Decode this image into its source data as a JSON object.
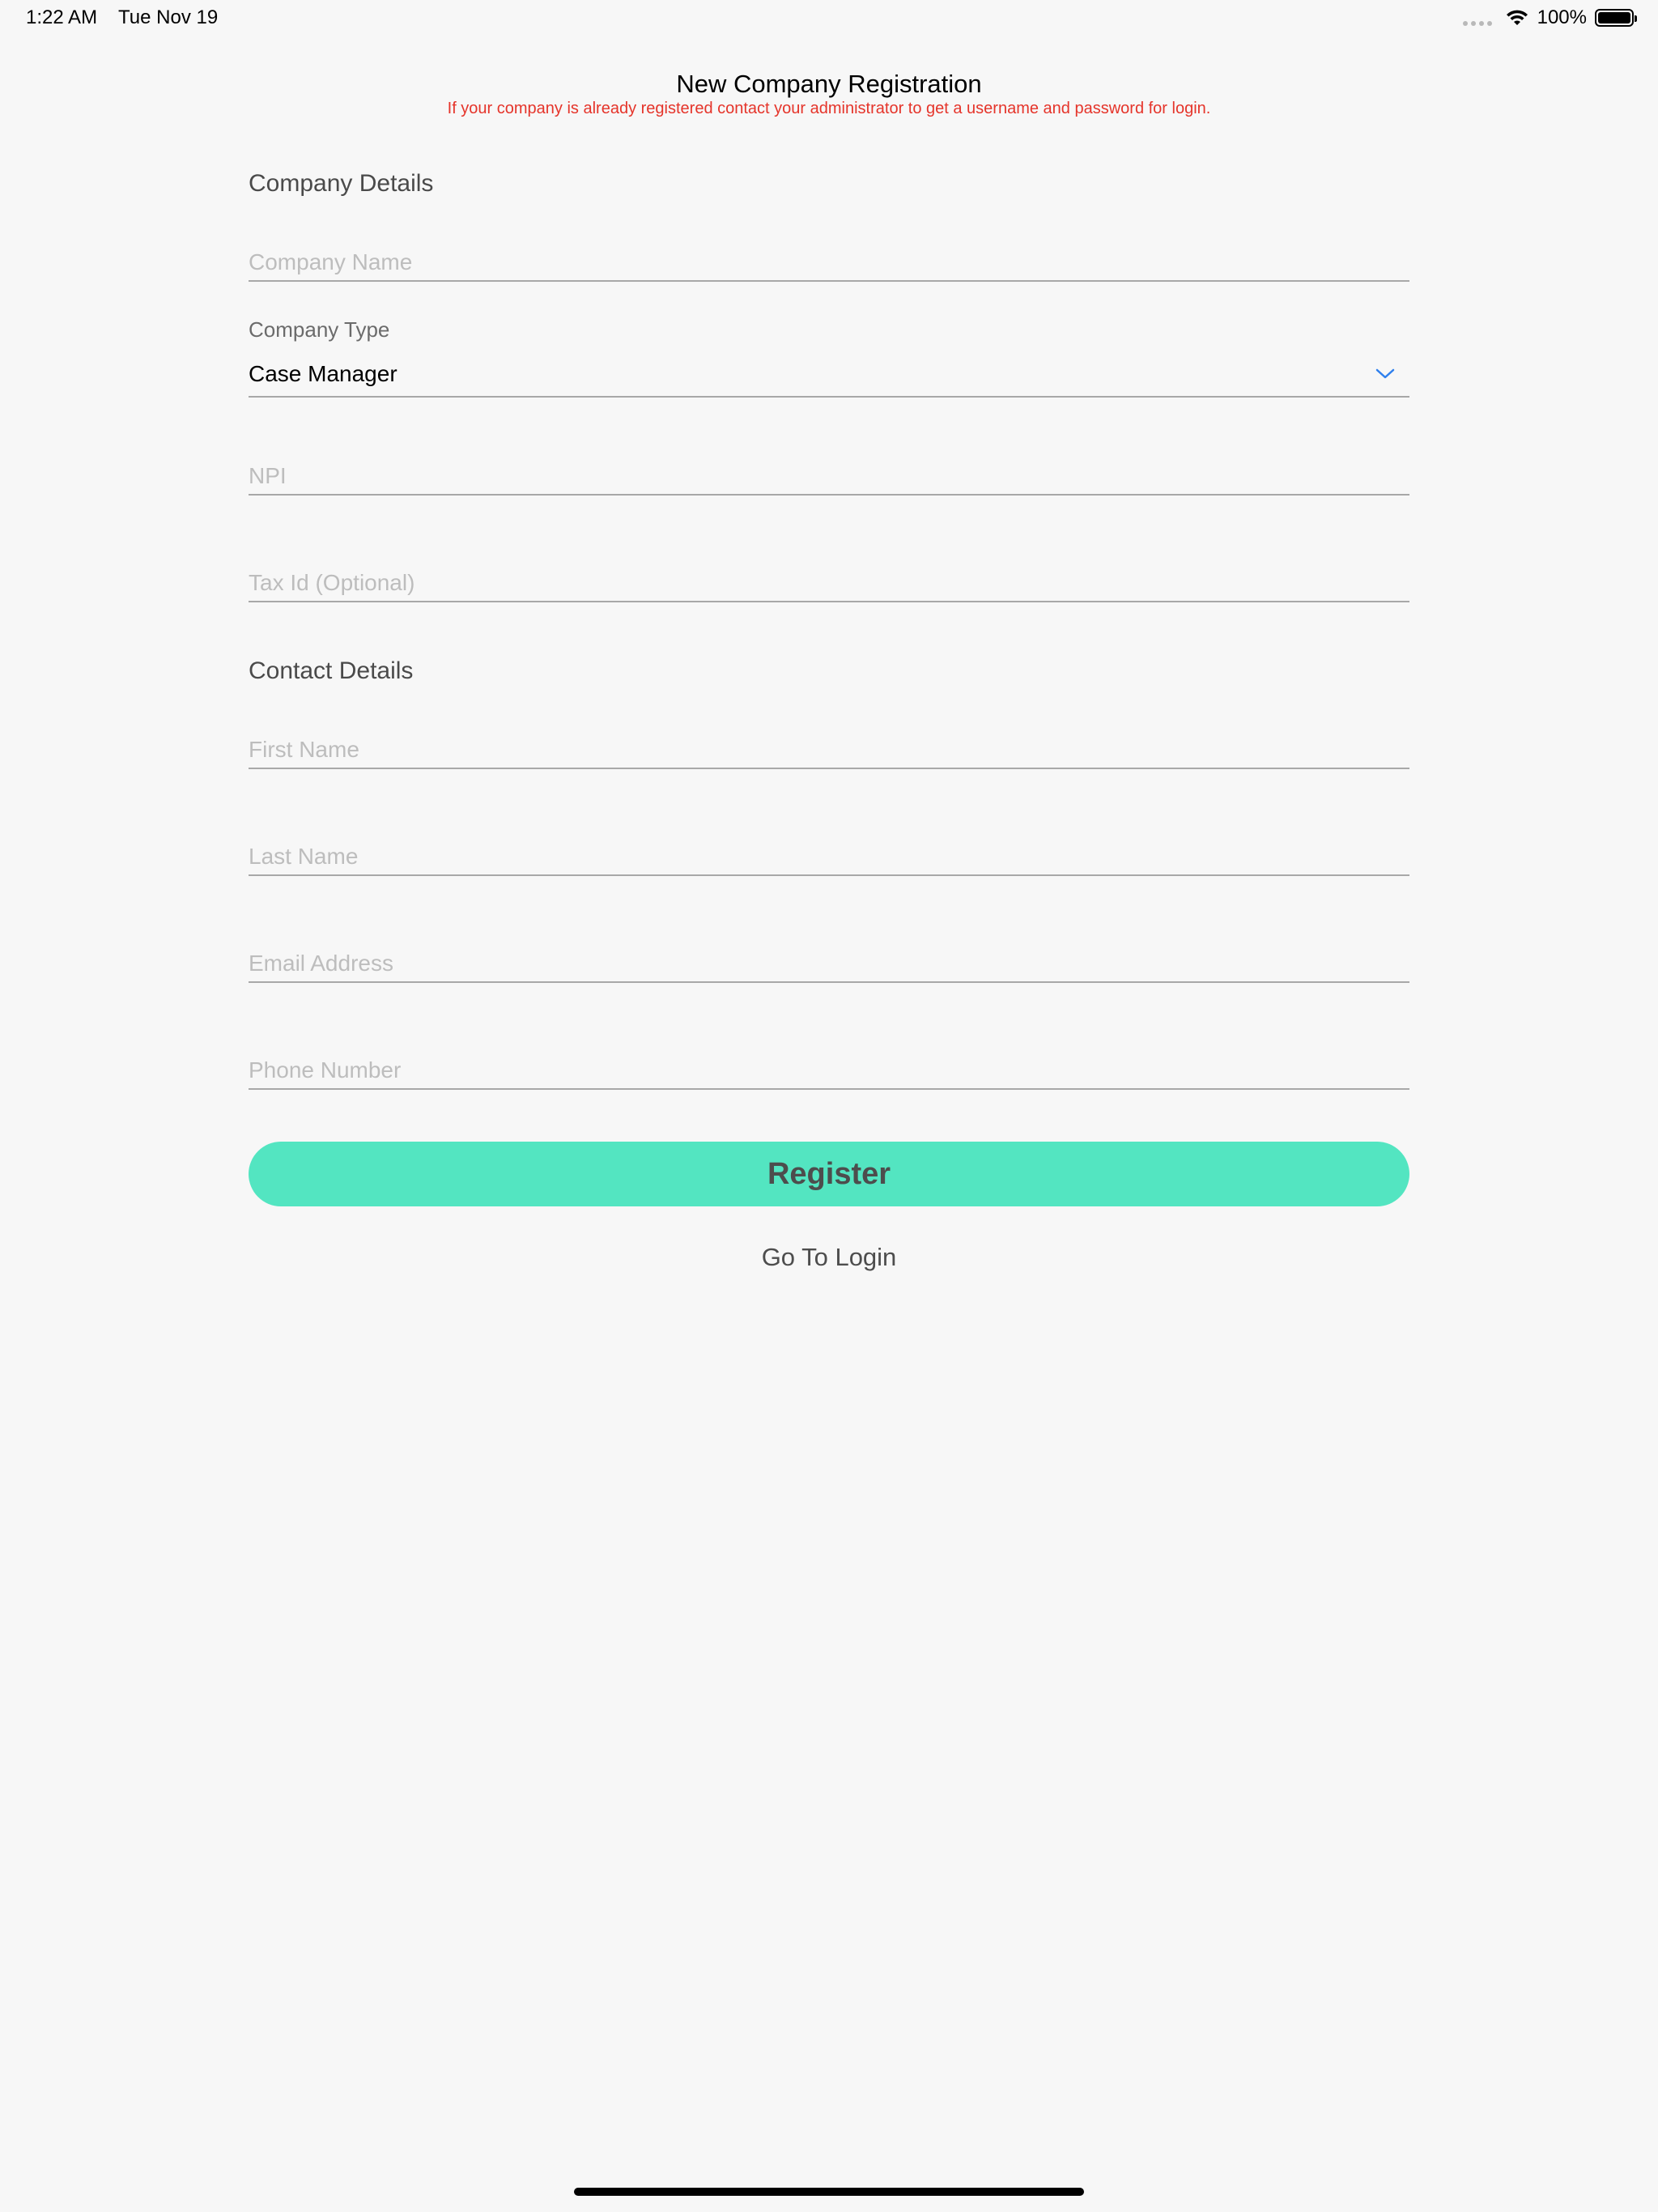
{
  "status_bar": {
    "time": "1:22 AM",
    "date": "Tue Nov 19",
    "battery": "100%"
  },
  "header": {
    "title": "New Company Registration",
    "notice": "If your company is already registered contact your administrator to get a username and password for login."
  },
  "company_details": {
    "heading": "Company Details",
    "company_name_placeholder": "Company Name",
    "company_type_label": "Company Type",
    "company_type_value": "Case Manager",
    "npi_placeholder": "NPI",
    "tax_id_placeholder": "Tax Id (Optional)"
  },
  "contact_details": {
    "heading": "Contact Details",
    "first_name_placeholder": "First Name",
    "last_name_placeholder": "Last Name",
    "email_placeholder": "Email Address",
    "phone_placeholder": "Phone Number"
  },
  "actions": {
    "register_label": "Register",
    "login_label": "Go To Login"
  },
  "colors": {
    "accent": "#53e5c1",
    "notice": "#e5342a",
    "chevron": "#2f80ed"
  }
}
